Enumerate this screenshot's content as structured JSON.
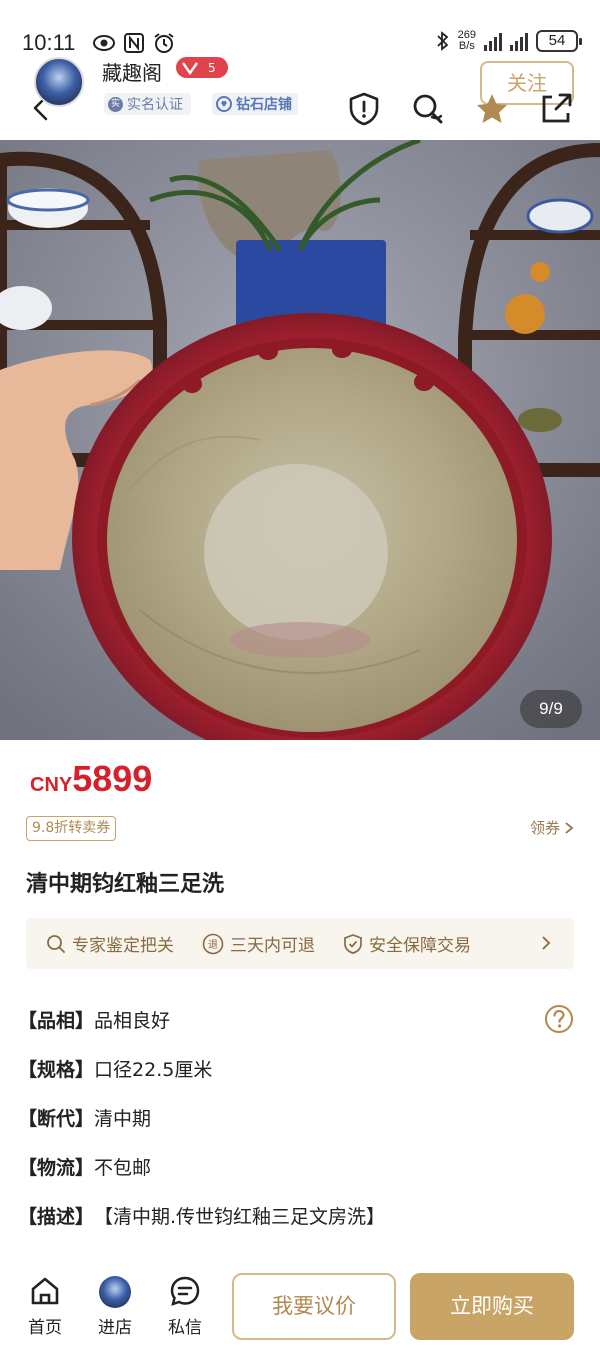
{
  "status": {
    "time": "10:11",
    "net_speed_value": "269",
    "net_speed_unit": "B/s",
    "battery": "54"
  },
  "header": {
    "shop_name": "藏趣阁",
    "level": "5",
    "cert_label": "实名认证",
    "cert_dot": "实",
    "diamond_label": "钻石店铺",
    "follow_label": "关注"
  },
  "gallery": {
    "page_indicator": "9/9"
  },
  "price": {
    "currency": "CNY",
    "value": "5899"
  },
  "coupon": {
    "tag": "9.8折转卖券",
    "link": "领券"
  },
  "product": {
    "title": "清中期钧红釉三足洗"
  },
  "guarantees": [
    {
      "label": "专家鉴定把关",
      "icon": "search-icon"
    },
    {
      "label": "三天内可退",
      "icon": "return-icon",
      "glyph": "退"
    },
    {
      "label": "安全保障交易",
      "icon": "shield-check-icon"
    }
  ],
  "attributes": [
    {
      "key": "【品相】",
      "value": "品相良好"
    },
    {
      "key": "【规格】",
      "value": "口径22.5厘米"
    },
    {
      "key": "【断代】",
      "value": "清中期"
    },
    {
      "key": "【物流】",
      "value": "不包邮"
    },
    {
      "key": "【描述】",
      "value": "【清中期.传世钧红釉三足文房洗】"
    }
  ],
  "bottom_nav": {
    "home": "首页",
    "shop": "进店",
    "message": "私信",
    "bargain": "我要议价",
    "buy": "立即购买"
  },
  "colors": {
    "accent_gold": "#c9a467",
    "price_red": "#d7202a"
  }
}
